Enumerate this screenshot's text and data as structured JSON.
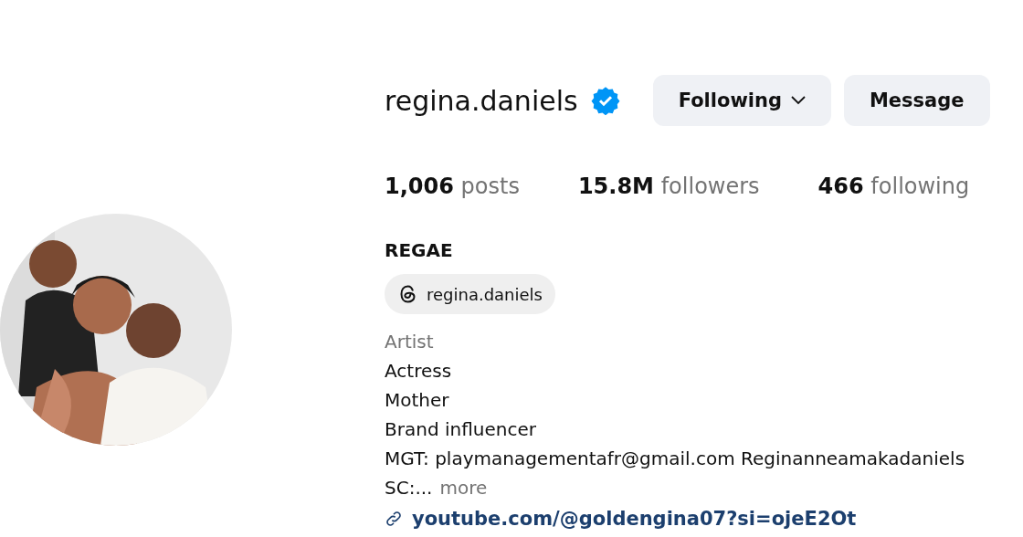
{
  "profile": {
    "username": "regina.daniels",
    "verified": true,
    "buttons": [
      {
        "label": "Following",
        "kind": "dropdown"
      },
      {
        "label": "Message",
        "kind": "plain"
      }
    ],
    "stats": [
      {
        "value": "1,006",
        "label": "posts"
      },
      {
        "value": "15.8M",
        "label": "followers"
      },
      {
        "value": "466",
        "label": "following"
      }
    ],
    "name": "REGAE",
    "threads_handle": "regina.daniels",
    "category": "Artist",
    "bio_lines": [
      "Actress",
      "Mother",
      "Brand influencer",
      "MGT: playmanagementafr@gmail.com Reginanneamakadaniels"
    ],
    "bio_end": "SC:...",
    "more": "more",
    "link": "youtube.com/@goldengina07?si=ojeE2Ot"
  }
}
